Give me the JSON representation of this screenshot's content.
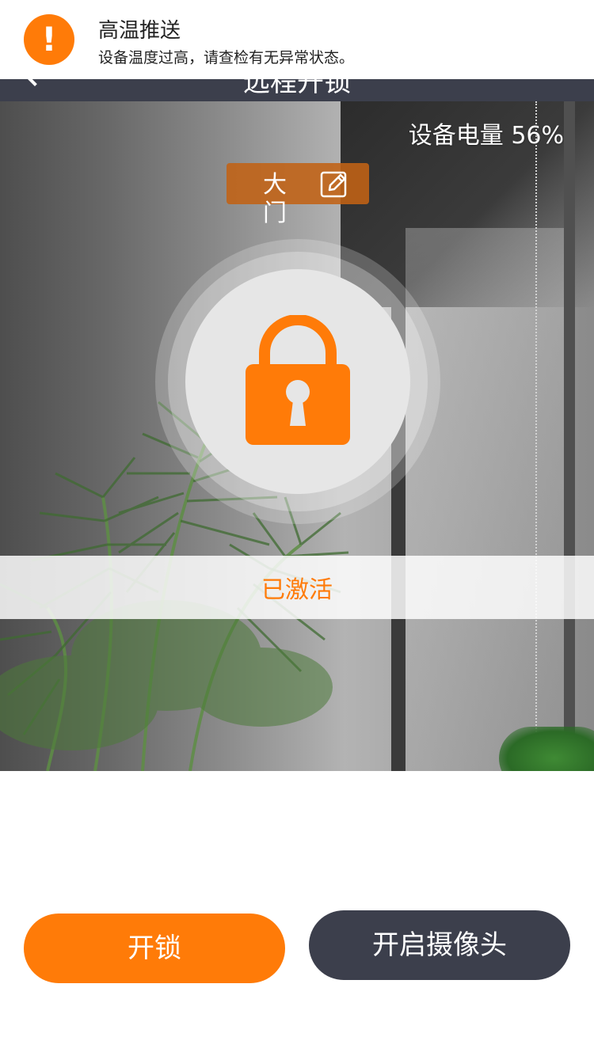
{
  "notification": {
    "title": "高温推送",
    "body": "设备温度过高，请查检有无异常状态。",
    "icon": "alert-icon",
    "icon_glyph": "!"
  },
  "navbar": {
    "title": "远程开锁"
  },
  "device": {
    "battery_label": "设备电量 56%",
    "door_name": "大门"
  },
  "lock": {
    "status": "已激活"
  },
  "actions": {
    "unlock_label": "开锁",
    "camera_label": "开启摄像头"
  },
  "colors": {
    "accent": "#ff7b08",
    "navbar": "#3c3f4c",
    "tag": "#c26214"
  }
}
